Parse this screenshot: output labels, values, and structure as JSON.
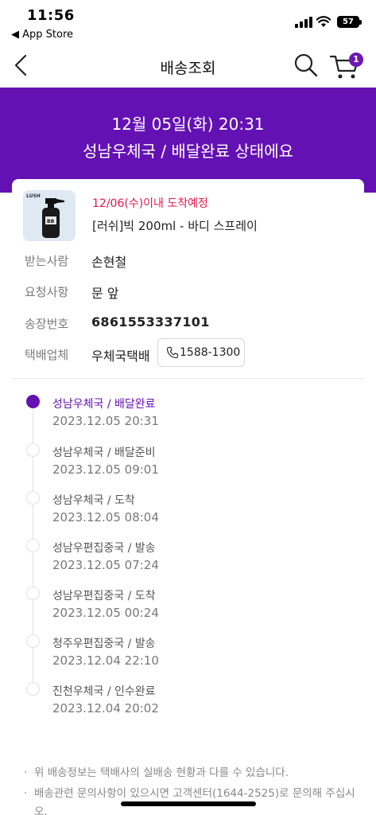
{
  "status_bar": {
    "time": "11:56",
    "back_app": "◀ App Store",
    "battery": "57"
  },
  "header": {
    "title": "배송조회",
    "cart_count": "1"
  },
  "banner": {
    "date": "12월 05일(화) 20:31",
    "status": "성남우체국 / 배달완료 상태에요"
  },
  "product": {
    "eta": "12/06(수)이내 도착예정",
    "name": "[러쉬]빅 200ml - 바디 스프레이",
    "brand_mark": "LUSH"
  },
  "info": {
    "recipient_label": "받는사람",
    "recipient_value": "손현철",
    "request_label": "요청사항",
    "request_value": "문 앞",
    "tracking_label": "송장번호",
    "tracking_value": "6861553337101",
    "courier_label": "택배업체",
    "courier_value": "우체국택배",
    "courier_phone": "1588-1300"
  },
  "timeline": [
    {
      "location": "성남우체국 / 배달완료",
      "time": "2023.12.05 20:31",
      "active": true
    },
    {
      "location": "성남우체국 / 배달준비",
      "time": "2023.12.05 09:01",
      "active": false
    },
    {
      "location": "성남우체국 / 도착",
      "time": "2023.12.05 08:04",
      "active": false
    },
    {
      "location": "성남우편집중국 / 발송",
      "time": "2023.12.05 07:24",
      "active": false
    },
    {
      "location": "성남우편집중국 / 도착",
      "time": "2023.12.05 00:24",
      "active": false
    },
    {
      "location": "청주우편집중국 / 발송",
      "time": "2023.12.04 22:10",
      "active": false
    },
    {
      "location": "진천우체국 / 인수완료",
      "time": "2023.12.04 20:02",
      "active": false
    }
  ],
  "notes": [
    "위 배송정보는 택배사의 실배송 현황과 다를 수 있습니다.",
    "배송관련 문의사항이 있으시면 고객센터(1644-2525)로 문의해 주십시오."
  ],
  "colors": {
    "accent": "#6411b3",
    "eta": "#e3174a"
  }
}
